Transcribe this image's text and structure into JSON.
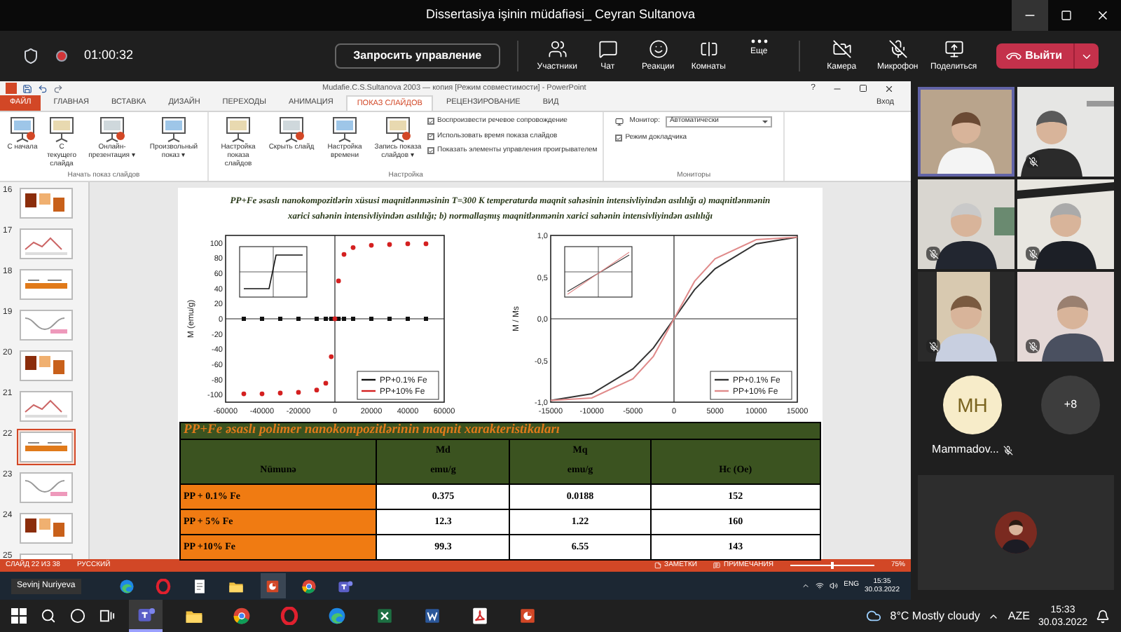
{
  "window": {
    "title": "Dissertasiya işinin müdafiəsi_ Ceyran Sultanova"
  },
  "meeting_bar": {
    "recording": true,
    "timer": "01:00:32",
    "request_control": "Запросить управление",
    "actions": [
      {
        "kind": "participants",
        "label": "Участники"
      },
      {
        "kind": "chat",
        "label": "Чат"
      },
      {
        "kind": "reactions",
        "label": "Реакции"
      },
      {
        "kind": "rooms",
        "label": "Комнаты"
      },
      {
        "kind": "more",
        "label": "Еще"
      }
    ],
    "devices": [
      {
        "kind": "camera",
        "label": "Камера"
      },
      {
        "kind": "microphone",
        "label": "Микрофон"
      },
      {
        "kind": "share",
        "label": "Поделиться"
      }
    ],
    "leave": "Выйти"
  },
  "powerpoint": {
    "title": "Mudafie.C.S.Sultanova 2003 — копия [Режим совместимости] - PowerPoint",
    "help": "?",
    "sign_in": "Вход",
    "tabs": [
      {
        "label": "ФАЙЛ",
        "kind": "file",
        "selected": false
      },
      {
        "label": "ГЛАВНАЯ",
        "selected": false
      },
      {
        "label": "ВСТАВКА",
        "selected": false
      },
      {
        "label": "ДИЗАЙН",
        "selected": false
      },
      {
        "label": "ПЕРЕХОДЫ",
        "selected": false
      },
      {
        "label": "АНИМАЦИЯ",
        "selected": false
      },
      {
        "label": "ПОКАЗ СЛАЙДОВ",
        "selected": true
      },
      {
        "label": "РЕЦЕНЗИРОВАНИЕ",
        "selected": false
      },
      {
        "label": "ВИД",
        "selected": false
      }
    ],
    "ribbon": [
      {
        "label": "Начать показ слайдов",
        "buttons": [
          "С начала",
          "С текущего слайда",
          "Онлайн-презентация ▾",
          "Произвольный показ ▾"
        ]
      },
      {
        "label": "Настройка",
        "buttons": [
          "Настройка показа слайдов",
          "Скрыть слайд",
          "Настройка времени",
          "Запись показа слайдов ▾"
        ],
        "checkboxes": [
          {
            "label": "Воспроизвести речевое сопровождение",
            "checked": true
          },
          {
            "label": "Использовать время показа слайдов",
            "checked": true
          },
          {
            "label": "Показать элементы управления проигрывателем",
            "checked": true
          }
        ]
      },
      {
        "label": "Мониторы",
        "monitor_label": "Монитор:",
        "monitor_value": "Автоматически",
        "checkboxes": [
          {
            "label": "Режим докладчика",
            "checked": true
          }
        ]
      }
    ],
    "thumbnails": [
      {
        "number": "16",
        "selected": false
      },
      {
        "number": "17",
        "selected": false
      },
      {
        "number": "18",
        "selected": false
      },
      {
        "number": "19",
        "selected": false
      },
      {
        "number": "20",
        "selected": false
      },
      {
        "number": "21",
        "selected": false
      },
      {
        "number": "22",
        "selected": true
      },
      {
        "number": "23",
        "selected": false
      },
      {
        "number": "24",
        "selected": false
      },
      {
        "number": "25",
        "selected": false
      }
    ],
    "slide": {
      "caption": "PP+Fe əsaslı nanokompozitlərin xüsusi maqnitlənməsinin T=300 K temperaturda maqnit sahəsinin intensivliyindən asılılığı a) maqnitlənmənin xarici sahənin intensivliyindən asılılığı; b) normallaşmış maqnitlənmənin xarici sahənin intensivliyindən asılılığı",
      "charts": [
        {
          "chart_data": {
            "type": "scatter",
            "ylabel": "M (emu/g)",
            "x": [
              -50000,
              -40000,
              -30000,
              -20000,
              -10000,
              -5000,
              -2000,
              0,
              2000,
              5000,
              10000,
              20000,
              30000,
              40000,
              50000
            ],
            "series": [
              {
                "name": "PP+0.1% Fe",
                "color": "#111111",
                "values": [
                  0,
                  0,
                  0,
                  0,
                  0,
                  0,
                  0,
                  0,
                  0,
                  0,
                  0,
                  0,
                  0,
                  0,
                  0
                ]
              },
              {
                "name": "PP+10% Fe",
                "color": "#d42020",
                "values": [
                  -99,
                  -99,
                  -98,
                  -97,
                  -94,
                  -85,
                  -50,
                  0,
                  50,
                  85,
                  94,
                  97,
                  98,
                  99,
                  99
                ]
              }
            ],
            "legend": "lower right",
            "xlim": [
              -60000,
              60000
            ],
            "ylim": [
              -110,
              110
            ],
            "xticks": [
              -60000,
              -40000,
              -20000,
              0,
              20000,
              40000,
              60000
            ],
            "yticks": [
              -100,
              -80,
              -60,
              -40,
              -20,
              0,
              20,
              40,
              60,
              80,
              100
            ]
          }
        },
        {
          "chart_data": {
            "type": "line",
            "ylabel": "M / Ms",
            "x": [
              -15000,
              -10000,
              -5000,
              -2500,
              0,
              2500,
              5000,
              10000,
              15000
            ],
            "series": [
              {
                "name": "PP+0.1% Fe",
                "color": "#333333",
                "values": [
                  -0.98,
                  -0.9,
                  -0.6,
                  -0.35,
                  0,
                  0.35,
                  0.6,
                  0.9,
                  0.98
                ]
              },
              {
                "name": "PP+10% Fe",
                "color": "#e08a8a",
                "values": [
                  -0.98,
                  -0.95,
                  -0.72,
                  -0.45,
                  0,
                  0.45,
                  0.72,
                  0.95,
                  0.98
                ]
              }
            ],
            "legend": "lower right",
            "xlim": [
              -15000,
              15000
            ],
            "ylim": [
              -1,
              1
            ],
            "xticks": [
              -15000,
              -10000,
              -5000,
              0,
              5000,
              10000,
              15000
            ],
            "yticks": [
              {
                "value": -1,
                "label": "-1,0"
              },
              {
                "value": -0.5,
                "label": "-0,5"
              },
              {
                "value": 0,
                "label": "0,0"
              },
              {
                "value": 0.5,
                "label": "0,5"
              },
              {
                "value": 1,
                "label": "1,0"
              }
            ]
          }
        }
      ],
      "table_title": "PP+Fe əsaslı polimer nanokompozitlərinin maqnit xarakteristikaları",
      "table": {
        "columns": [
          "Nümunə",
          "Md\nemu/g",
          "Mq\nemu/g",
          "Hc (Oe)"
        ],
        "rows": [
          [
            "PP + 0.1% Fe",
            "0.375",
            "0.0188",
            "152"
          ],
          [
            "PP + 5% Fe",
            "12.3",
            "1.22",
            "160"
          ],
          [
            "PP +10% Fe",
            "99.3",
            "6.55",
            "143"
          ]
        ]
      }
    },
    "status_bar": {
      "slide": "СЛАЙД 22 ИЗ 38",
      "language": "РУССКИЙ",
      "notes": "ЗАМЕТКИ",
      "comments": "ПРИМЕЧАНИЯ",
      "zoom_slider": {
        "level": 0.5
      },
      "zoom": "75%"
    }
  },
  "presenter_label": "Sevinj Nuriyeva",
  "remote_taskbar": {
    "apps": [
      {
        "kind": "edge",
        "selected": false
      },
      {
        "kind": "opera",
        "selected": false
      },
      {
        "kind": "notepad",
        "selected": false
      },
      {
        "kind": "explorer",
        "selected": false
      },
      {
        "kind": "powerpoint",
        "selected": true
      },
      {
        "kind": "chrome",
        "selected": false
      },
      {
        "kind": "teams",
        "selected": false
      }
    ],
    "language": "ENG",
    "time": "15:35",
    "date": "30.03.2022"
  },
  "gallery": {
    "tiles": [
      {
        "selected": true,
        "muted": false
      },
      {
        "selected": false,
        "muted": true
      },
      {
        "selected": false,
        "muted": true
      },
      {
        "selected": false,
        "muted": true
      },
      {
        "selected": false,
        "muted": true
      },
      {
        "selected": false,
        "muted": true
      }
    ],
    "avatar": {
      "initials": "MH",
      "name": "Mammadov...",
      "muted": true
    },
    "overflow": "+8"
  },
  "taskbar": {
    "apps": [
      {
        "kind": "teams",
        "selected": true
      },
      {
        "kind": "explorer",
        "selected": false
      },
      {
        "kind": "chrome",
        "selected": false
      },
      {
        "kind": "opera",
        "selected": false
      },
      {
        "kind": "edge",
        "selected": false
      },
      {
        "kind": "excel",
        "selected": false
      },
      {
        "kind": "word",
        "selected": false
      },
      {
        "kind": "acrobat",
        "selected": false
      },
      {
        "kind": "powerpoint",
        "selected": false
      }
    ],
    "weather": "8°C Mostly cloudy",
    "language": "AZE",
    "time": "15:33",
    "date": "30.03.2022"
  }
}
